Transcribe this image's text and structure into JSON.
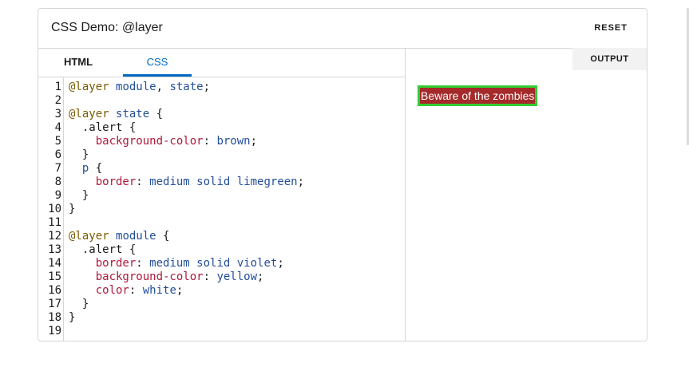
{
  "header": {
    "title": "CSS Demo: @layer",
    "reset_label": "RESET"
  },
  "tabs": [
    {
      "label": "HTML",
      "active": false
    },
    {
      "label": "CSS",
      "active": true
    }
  ],
  "code": {
    "line_numbers": [
      "1",
      "2",
      "3",
      "4",
      "5",
      "6",
      "7",
      "8",
      "9",
      "10",
      "11",
      "12",
      "13",
      "14",
      "15",
      "16",
      "17",
      "18",
      "19"
    ],
    "lines": [
      [
        {
          "t": "kw",
          "v": "@layer"
        },
        {
          "t": "p",
          "v": " "
        },
        {
          "t": "name",
          "v": "module"
        },
        {
          "t": "p",
          "v": ", "
        },
        {
          "t": "name",
          "v": "state"
        },
        {
          "t": "p",
          "v": ";"
        }
      ],
      [],
      [
        {
          "t": "kw",
          "v": "@layer"
        },
        {
          "t": "p",
          "v": " "
        },
        {
          "t": "name",
          "v": "state"
        },
        {
          "t": "p",
          "v": " {"
        }
      ],
      [
        {
          "t": "p",
          "v": "  .alert {"
        }
      ],
      [
        {
          "t": "p",
          "v": "    "
        },
        {
          "t": "prop",
          "v": "background-color"
        },
        {
          "t": "p",
          "v": ": "
        },
        {
          "t": "val",
          "v": "brown"
        },
        {
          "t": "p",
          "v": ";"
        }
      ],
      [
        {
          "t": "p",
          "v": "  }"
        }
      ],
      [
        {
          "t": "p",
          "v": "  "
        },
        {
          "t": "name",
          "v": "p"
        },
        {
          "t": "p",
          "v": " {"
        }
      ],
      [
        {
          "t": "p",
          "v": "    "
        },
        {
          "t": "prop",
          "v": "border"
        },
        {
          "t": "p",
          "v": ": "
        },
        {
          "t": "val",
          "v": "medium solid limegreen"
        },
        {
          "t": "p",
          "v": ";"
        }
      ],
      [
        {
          "t": "p",
          "v": "  }"
        }
      ],
      [
        {
          "t": "p",
          "v": "}"
        }
      ],
      [],
      [
        {
          "t": "kw",
          "v": "@layer"
        },
        {
          "t": "p",
          "v": " "
        },
        {
          "t": "name",
          "v": "module"
        },
        {
          "t": "p",
          "v": " {"
        }
      ],
      [
        {
          "t": "p",
          "v": "  .alert {"
        }
      ],
      [
        {
          "t": "p",
          "v": "    "
        },
        {
          "t": "prop",
          "v": "border"
        },
        {
          "t": "p",
          "v": ": "
        },
        {
          "t": "val",
          "v": "medium solid violet"
        },
        {
          "t": "p",
          "v": ";"
        }
      ],
      [
        {
          "t": "p",
          "v": "    "
        },
        {
          "t": "prop",
          "v": "background-color"
        },
        {
          "t": "p",
          "v": ": "
        },
        {
          "t": "val",
          "v": "yellow"
        },
        {
          "t": "p",
          "v": ";"
        }
      ],
      [
        {
          "t": "p",
          "v": "    "
        },
        {
          "t": "prop",
          "v": "color"
        },
        {
          "t": "p",
          "v": ": "
        },
        {
          "t": "val",
          "v": "white"
        },
        {
          "t": "p",
          "v": ";"
        }
      ],
      [
        {
          "t": "p",
          "v": "  }"
        }
      ],
      [
        {
          "t": "p",
          "v": "}"
        }
      ],
      []
    ]
  },
  "output": {
    "label": "OUTPUT",
    "paragraph_text": "Beware of the zombies"
  },
  "colors": {
    "accent": "#0069c2",
    "alert_background": "#a52a2a",
    "alert_border": "#32cd32",
    "alert_text": "#ffffff",
    "syntax_keyword": "#7a5b00",
    "syntax_name": "#224e9b",
    "syntax_property": "#b0183a"
  }
}
